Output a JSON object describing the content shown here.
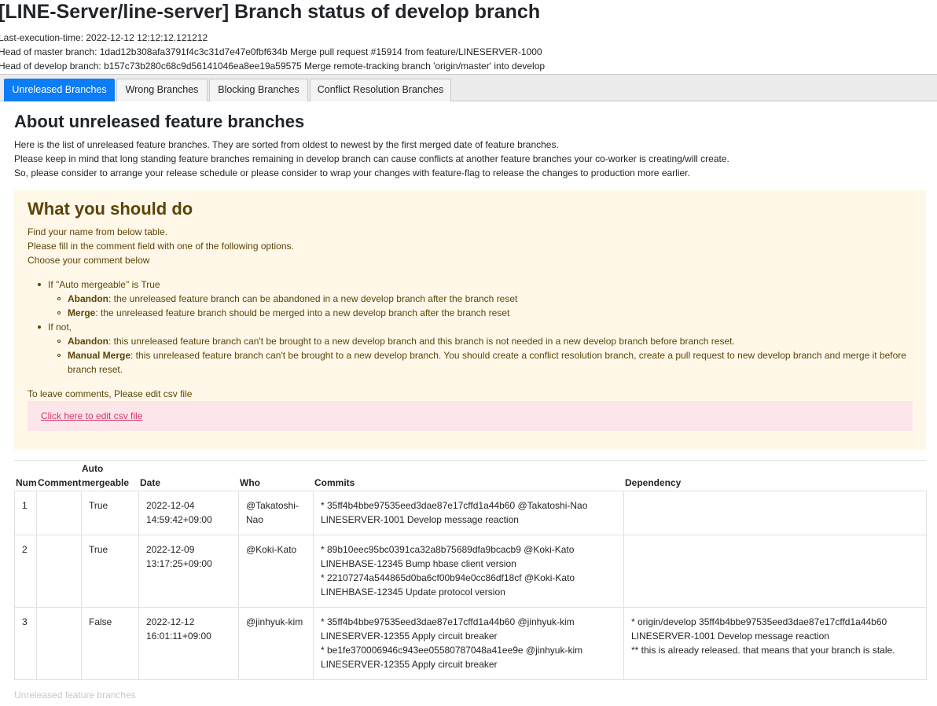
{
  "header": {
    "title": "[LINE-Server/line-server] Branch status of develop branch",
    "last_execution": "Last-execution-time: 2022-12-12 12:12:12.121212",
    "master_head": "Head of master branch: 1dad12b308afa3791f4c3c31d7e47e0fbf634b Merge pull request #15914 from feature/LINESERVER-1000",
    "develop_head": "Head of develop branch: b157c73b280c68c9d56141046ea8ee19a59575 Merge remote-tracking branch 'origin/master' into develop"
  },
  "tabs": [
    {
      "label": "Unreleased Branches",
      "active": true
    },
    {
      "label": "Wrong Branches",
      "active": false
    },
    {
      "label": "Blocking Branches",
      "active": false
    },
    {
      "label": "Conflict Resolution Branches",
      "active": false
    }
  ],
  "about": {
    "title": "About unreleased feature branches",
    "lines": [
      "Here is the list of unreleased feature branches. They are sorted from oldest to newest by the first merged date of feature branches.",
      "Please keep in mind that long standing feature branches remaining in develop branch can cause conflicts at another feature branches your co-worker is creating/will create.",
      "So, please consider to arrange your release schedule or please consider to wrap your changes with feature-flag to release the changes to production more earlier."
    ]
  },
  "notice": {
    "title": "What you should do",
    "lines": [
      "Find your name from below table.",
      "Please fill in the comment field with one of the following options.",
      "Choose your comment below"
    ],
    "case_true": "If \"Auto mergeable\" is True",
    "true_abandon_term": "Abandon",
    "true_abandon_text": ": the unreleased feature branch can be abandoned in a new develop branch after the branch reset",
    "true_merge_term": "Merge",
    "true_merge_text": ": the unreleased feature branch should be merged into a new develop branch after the branch reset",
    "case_false": "If not,",
    "false_abandon_term": "Abandon",
    "false_abandon_text": ": this unreleased feature branch can't be brought to a new develop branch and this branch is not needed in a new develop branch before branch reset.",
    "false_manual_term": "Manual Merge",
    "false_manual_text": ": this unreleased feature branch can't be brought to a new develop branch. You should create a conflict resolution branch, create a pull request to new develop branch and merge it before branch reset.",
    "leave_comments": "To leave comments, Please edit csv file",
    "edit_link": "Click here to edit csv file"
  },
  "table": {
    "headers": {
      "num": "Num",
      "comment": "Comment",
      "auto": "Auto mergeable",
      "date": "Date",
      "who": "Who",
      "commits": "Commits",
      "dependency": "Dependency"
    },
    "rows": [
      {
        "num": "1",
        "comment": "",
        "auto": "True",
        "date": "2022-12-04 14:59:42+09:00",
        "who": "@Takatoshi-Nao",
        "commits": "* 35ff4b4bbe97535eed3dae87e17cffd1a44b60 @Takatoshi-Nao LINESERVER-1001 Develop message reaction",
        "dependency": ""
      },
      {
        "num": "2",
        "comment": "",
        "auto": "True",
        "date": "2022-12-09 13:17:25+09:00",
        "who": "@Koki-Kato",
        "commits": "* 89b10eec95bc0391ca32a8b75689dfa9bcacb9 @Koki-Kato LINEHBASE-12345 Bump hbase client version\n* 22107274a544865d0ba6cf00b94e0cc86df18cf @Koki-Kato LINEHBASE-12345 Update protocol version",
        "dependency": ""
      },
      {
        "num": "3",
        "comment": "",
        "auto": "False",
        "date": "2022-12-12 16:01:11+09:00",
        "who": "@jinhyuk-kim",
        "commits": "* 35ff4b4bbe97535eed3dae87e17cffd1a44b60 @jinhyuk-kim LINESERVER-12355 Apply circuit breaker\n* be1fe370006946c943ee05580787048a41ee9e @jinhyuk-kim LINESERVER-12355 Apply circuit breaker",
        "dependency": "* origin/develop 35ff4b4bbe97535eed3dae87e17cffd1a44b60 LINESERVER-1001 Develop message reaction\n** this is already released. that means that your branch is stale."
      }
    ]
  },
  "footer_caption": "Unreleased feature branches"
}
